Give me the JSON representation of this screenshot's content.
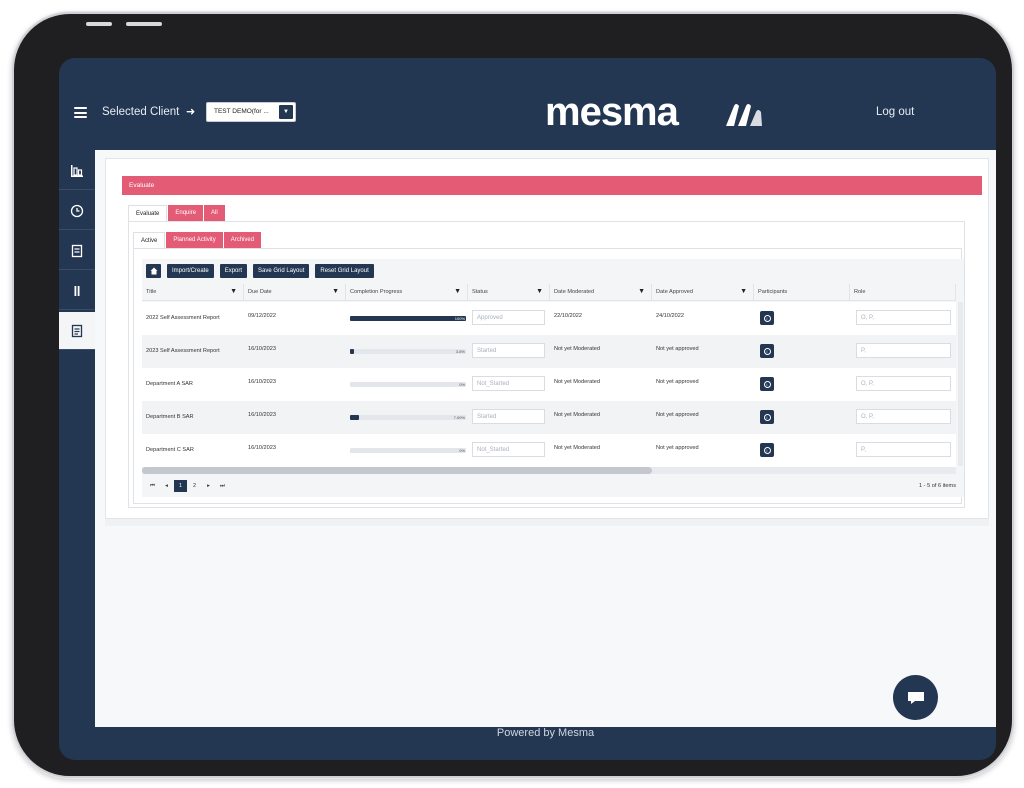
{
  "header": {
    "selected_client_label": "Selected Client",
    "client_value": "TEST DEMO(for ...",
    "logo_text": "mesma",
    "logout_label": "Log out"
  },
  "sidebar": {
    "items": [
      "dashboard-icon",
      "clock-icon",
      "document-icon",
      "pause-icon",
      "clipboard-icon"
    ],
    "active_index": 4
  },
  "page": {
    "section_title": "Evaluate",
    "tabs_primary": [
      "Evaluate",
      "Enquire",
      "All"
    ],
    "tabs_secondary": [
      "Active",
      "Planned Activity",
      "Archived"
    ]
  },
  "toolbar": {
    "import_label": "Import/Create",
    "export_label": "Export",
    "save_layout_label": "Save Grid Layout",
    "reset_layout_label": "Reset Grid Layout"
  },
  "table": {
    "columns": [
      "Title",
      "Due Date",
      "Completion Progress",
      "Status",
      "Date Moderated",
      "Date Approved",
      "Participants",
      "Role"
    ],
    "rows": [
      {
        "title": "2022 Self Assessment Report",
        "due": "09/12/2022",
        "progress": 100,
        "progress_label": "100%",
        "status": "Approved",
        "moderated": "22/10/2022",
        "approved": "24/10/2022",
        "role": "O, P,"
      },
      {
        "title": "2023 Self Assessment Report",
        "due": "16/10/2023",
        "progress": 3.8,
        "progress_label": "3.8%",
        "status": "Started",
        "moderated": "Not yet Moderated",
        "approved": "Not yet approved",
        "role": "P,"
      },
      {
        "title": "Department A SAR",
        "due": "16/10/2023",
        "progress": 0,
        "progress_label": "0%",
        "status": "Not_Started",
        "moderated": "Not yet Moderated",
        "approved": "Not yet approved",
        "role": "O, P,"
      },
      {
        "title": "Department B SAR",
        "due": "16/10/2023",
        "progress": 7.69,
        "progress_label": "7.69%",
        "status": "Started",
        "moderated": "Not yet Moderated",
        "approved": "Not yet approved",
        "role": "O, P,"
      },
      {
        "title": "Department C SAR",
        "due": "16/10/2023",
        "progress": 0,
        "progress_label": "0%",
        "status": "Not_Started",
        "moderated": "Not yet Moderated",
        "approved": "Not yet approved",
        "role": "P,"
      }
    ]
  },
  "pager": {
    "pages": [
      "1",
      "2"
    ],
    "current": "1",
    "summary": "1 - 5 of 6 items"
  },
  "footer": {
    "text": "Powered by Mesma"
  },
  "colors": {
    "navy": "#233752",
    "accent_pink": "#e35b75",
    "content_bg": "#f7f8fa"
  }
}
